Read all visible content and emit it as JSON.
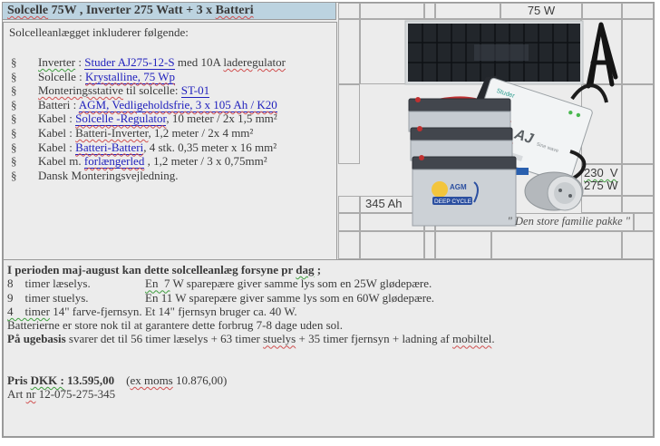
{
  "title": {
    "segments": [
      {
        "t": "Solcelle",
        "s": "sp-red"
      },
      {
        "t": " 75W , Inverter 275 Watt + 3 x ",
        "s": ""
      },
      {
        "t": "Batteri",
        "s": "sp-red"
      }
    ]
  },
  "intro": "Solcelleanlægget inkluderer følgende:",
  "bullet": "§",
  "package_list": [
    {
      "segments": [
        {
          "t": "Inverter",
          "s": "sp-green"
        },
        {
          "t": " : ",
          "s": ""
        },
        {
          "t": "Studer AJ275-12-S",
          "s": "lnk"
        },
        {
          "t": " med 10A ",
          "s": ""
        },
        {
          "t": "laderegulator",
          "s": "sp-red"
        }
      ]
    },
    {
      "segments": [
        {
          "t": "Solcelle : ",
          "s": ""
        },
        {
          "t": "Krystalline, 75 Wp",
          "s": "lnk sp-red"
        }
      ]
    },
    {
      "segments": [
        {
          "t": "Monteringsstative",
          "s": "sp-red"
        },
        {
          "t": " til solcelle: ",
          "s": ""
        },
        {
          "t": "ST-01",
          "s": "lnk"
        }
      ]
    },
    {
      "segments": [
        {
          "t": "Batteri : ",
          "s": ""
        },
        {
          "t": "AGM, Vedligeholdsfrie, 3 x 105 Ah / K20",
          "s": "lnk sp-red"
        }
      ]
    },
    {
      "segments": [
        {
          "t": "Kabel : ",
          "s": ""
        },
        {
          "t": "Solcelle -Regulator",
          "s": "lnk sp-red"
        },
        {
          "t": ", 10 meter / 2x 1,5 mm²",
          "s": ""
        }
      ]
    },
    {
      "segments": [
        {
          "t": "Kabel : ",
          "s": ""
        },
        {
          "t": "Batteri-Inverter",
          "s": "sp-red"
        },
        {
          "t": ", 1,2 meter / 2x 4 mm²",
          "s": ""
        }
      ]
    },
    {
      "segments": [
        {
          "t": "Kabel : ",
          "s": ""
        },
        {
          "t": "Batteri-Batteri",
          "s": "lnk sp-red"
        },
        {
          "t": ", 4 stk. 0,35 meter x 16 mm²",
          "s": ""
        }
      ]
    },
    {
      "segments": [
        {
          "t": "Kabel m. ",
          "s": ""
        },
        {
          "t": "forlængerled",
          "s": "lnk sp-red"
        },
        {
          "t": " , 1,2 meter / 3 x 0,75mm²",
          "s": ""
        }
      ]
    },
    {
      "segments": [
        {
          "t": "Dansk Monteringsvejledning.",
          "s": ""
        }
      ]
    }
  ],
  "product_labels": {
    "panel_watt": "75 W",
    "battery_capacity": "345 Ah",
    "output_voltage": "230  V",
    "output_watt": "275 W",
    "tagline": "\" Den store familie pakke \""
  },
  "usage": {
    "heading_segments": [
      {
        "t": "I perioden maj-august kan dette solcelleanlæg forsyne pr ",
        "s": "bold"
      },
      {
        "t": "dag",
        "s": "bold sp-green"
      },
      {
        "t": " ;",
        "s": "bold"
      }
    ],
    "lines": [
      {
        "left": "8    timer læselys.",
        "segments": [
          {
            "t": "En  7",
            "s": "sp-green"
          },
          {
            "t": " W sparepære giver samme lys som en 25W glødepære.",
            "s": ""
          }
        ]
      },
      {
        "left": "9    timer stuelys.",
        "segments": [
          {
            "t": "En 11 W sparepære giver samme lys som en 60W glødepære.",
            "s": ""
          }
        ]
      },
      {
        "left": "",
        "segments": [
          {
            "t": "4    timer",
            "s": "sp-green"
          },
          {
            "t": " 14\" farve-fjernsyn. Et 14\" fjernsyn bruger ca. 40 W.",
            "s": ""
          }
        ]
      }
    ],
    "note1": "Batterierne er store nok til at garantere dette forbrug 7-8 dage uden sol.",
    "note2_segments": [
      {
        "t": "På ugebasis",
        "s": "bold"
      },
      {
        "t": " svarer det til 56 timer læselys + 63 timer ",
        "s": ""
      },
      {
        "t": "stuelys",
        "s": "sp-red"
      },
      {
        "t": " + 35 timer fjernsyn + ladning af ",
        "s": ""
      },
      {
        "t": "mobiltel",
        "s": "sp-red"
      },
      {
        "t": ".",
        "s": ""
      }
    ]
  },
  "pricing": {
    "price_segments": [
      {
        "t": "Pris ",
        "s": "bold"
      },
      {
        "t": "DKK :",
        "s": "bold sp-green"
      },
      {
        "t": " 13.595,00",
        "s": "bold"
      },
      {
        "t": "    (",
        "s": ""
      },
      {
        "t": "ex moms",
        "s": "sp-red"
      },
      {
        "t": " 10.876,00)",
        "s": ""
      }
    ],
    "art_segments": [
      {
        "t": "Art ",
        "s": ""
      },
      {
        "t": "nr",
        "s": "sp-red"
      },
      {
        "t": " 12-075-275-345",
        "s": ""
      }
    ]
  },
  "colors": {
    "title_background": "#bcd3e0",
    "link": "#2121bd",
    "misspell_red": "#d05050",
    "misspell_green": "#3f9e3f",
    "sheet_background": "#ececec"
  }
}
